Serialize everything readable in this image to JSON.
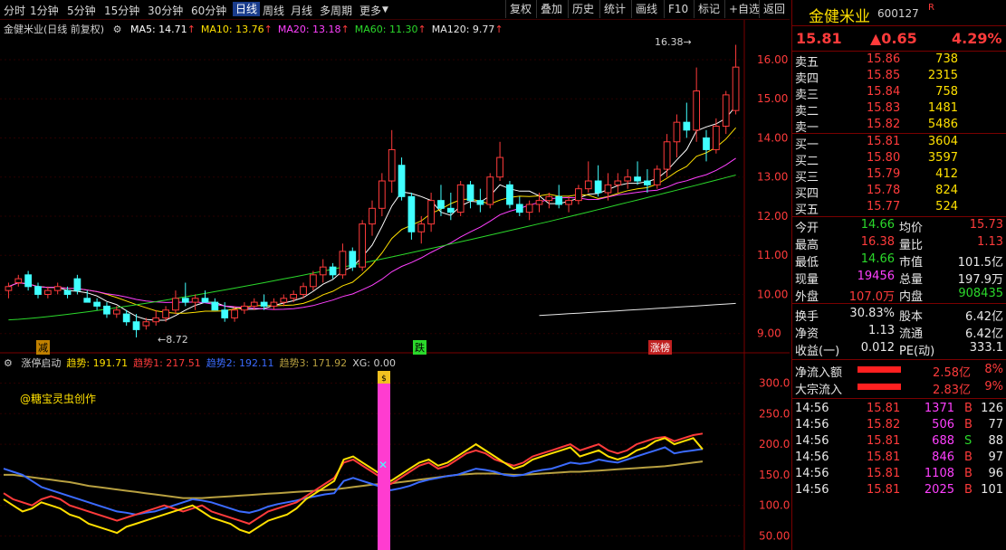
{
  "toolbar": {
    "periods": [
      "分时",
      "1分钟",
      "5分钟",
      "15分钟",
      "30分钟",
      "60分钟",
      "日线",
      "周线",
      "月线",
      "多周期",
      "更多"
    ],
    "active_period": "日线",
    "right_buttons": [
      "复权",
      "叠加",
      "历史",
      "统计",
      "画线",
      "F10",
      "标记",
      "+自选",
      "返回"
    ]
  },
  "chart_title": "金健米业(日线 前复权)",
  "ma_legend": [
    {
      "label": "MA5: 14.71",
      "color": "#ffffff"
    },
    {
      "label": "MA10: 13.76",
      "color": "#ffe000"
    },
    {
      "label": "MA20: 13.18",
      "color": "#ff40ff"
    },
    {
      "label": "MA60: 11.30",
      "color": "#2bd82b"
    },
    {
      "label": "MA120: 9.77",
      "color": "#e8e8e8"
    }
  ],
  "sub_legend": [
    {
      "label": "涨停启动",
      "color": "#d0d0d0"
    },
    {
      "label": "趋势: 191.71",
      "color": "#ffe000"
    },
    {
      "label": "趋势1: 217.51",
      "color": "#ff3b3b"
    },
    {
      "label": "趋势2: 192.11",
      "color": "#3b6bff"
    },
    {
      "label": "趋势3: 171.92",
      "color": "#b8a040"
    },
    {
      "label": "XG: 0.00",
      "color": "#d0d0d0"
    }
  ],
  "watermark_author": "@糖宝灵虫创作",
  "markers": {
    "low_label": "8.72",
    "high_label": "16.38",
    "tag1": "减",
    "tag2": "跌",
    "tag3": "涨榜"
  },
  "chart_data": [
    {
      "type": "candlestick",
      "title": "金健米业(日线 前复权)",
      "ylim": [
        8.6,
        16.6
      ],
      "y_ticks": [
        "9.00",
        "10.00",
        "11.00",
        "12.00",
        "13.00",
        "14.00",
        "15.00",
        "16.00"
      ],
      "ohlc": [
        [
          10.1,
          10.3,
          9.9,
          10.2
        ],
        [
          10.3,
          10.5,
          10.2,
          10.4
        ],
        [
          10.5,
          10.6,
          10.1,
          10.2
        ],
        [
          10.2,
          10.3,
          9.9,
          10.0
        ],
        [
          10.0,
          10.2,
          9.9,
          10.1
        ],
        [
          10.1,
          10.3,
          10.0,
          10.2
        ],
        [
          10.1,
          10.2,
          9.9,
          10.0
        ],
        [
          10.4,
          10.5,
          10.0,
          10.1
        ],
        [
          9.9,
          10.1,
          9.8,
          9.8
        ],
        [
          9.8,
          9.9,
          9.6,
          9.7
        ],
        [
          9.7,
          9.8,
          9.4,
          9.5
        ],
        [
          9.5,
          9.7,
          9.4,
          9.6
        ],
        [
          9.5,
          9.6,
          9.2,
          9.3
        ],
        [
          9.3,
          9.5,
          8.9,
          9.1
        ],
        [
          9.2,
          9.4,
          9.1,
          9.3
        ],
        [
          9.3,
          9.6,
          9.2,
          9.4
        ],
        [
          9.4,
          9.7,
          9.3,
          9.6
        ],
        [
          9.6,
          10.1,
          9.5,
          9.9
        ],
        [
          9.9,
          10.3,
          9.7,
          9.8
        ],
        [
          9.8,
          10.0,
          9.6,
          9.9
        ],
        [
          9.9,
          10.1,
          9.8,
          9.8
        ],
        [
          9.8,
          9.9,
          9.6,
          9.6
        ],
        [
          9.6,
          9.8,
          9.3,
          9.4
        ],
        [
          9.4,
          9.7,
          9.3,
          9.6
        ],
        [
          9.6,
          9.8,
          9.5,
          9.7
        ],
        [
          9.7,
          9.9,
          9.6,
          9.8
        ],
        [
          9.8,
          10.0,
          9.6,
          9.7
        ],
        [
          9.7,
          9.9,
          9.6,
          9.8
        ],
        [
          9.8,
          10.0,
          9.7,
          9.9
        ],
        [
          9.9,
          10.1,
          9.8,
          10.0
        ],
        [
          10.0,
          10.3,
          9.9,
          10.2
        ],
        [
          10.2,
          10.6,
          10.1,
          10.5
        ],
        [
          10.5,
          10.9,
          10.3,
          10.7
        ],
        [
          10.7,
          10.8,
          10.4,
          10.5
        ],
        [
          10.5,
          11.3,
          10.4,
          11.1
        ],
        [
          11.1,
          11.2,
          10.6,
          10.7
        ],
        [
          10.7,
          11.9,
          10.6,
          11.8
        ],
        [
          11.8,
          12.4,
          11.5,
          12.2
        ],
        [
          12.2,
          13.1,
          12.0,
          12.9
        ],
        [
          12.9,
          14.2,
          12.6,
          13.7
        ],
        [
          13.3,
          13.5,
          12.4,
          12.5
        ],
        [
          12.5,
          12.6,
          11.4,
          11.6
        ],
        [
          11.6,
          12.0,
          11.3,
          11.8
        ],
        [
          11.8,
          12.6,
          11.6,
          12.4
        ],
        [
          12.4,
          12.8,
          12.0,
          12.2
        ],
        [
          12.2,
          12.6,
          11.9,
          12.1
        ],
        [
          12.1,
          12.9,
          12.0,
          12.8
        ],
        [
          12.8,
          12.9,
          12.2,
          12.4
        ],
        [
          12.4,
          12.7,
          12.1,
          12.3
        ],
        [
          12.3,
          13.1,
          12.2,
          13.0
        ],
        [
          13.0,
          13.9,
          12.9,
          13.5
        ],
        [
          12.8,
          12.9,
          12.2,
          12.3
        ],
        [
          12.3,
          12.5,
          12.0,
          12.1
        ],
        [
          12.1,
          12.4,
          11.9,
          12.3
        ],
        [
          12.3,
          12.6,
          12.1,
          12.4
        ],
        [
          12.4,
          12.6,
          12.2,
          12.5
        ],
        [
          12.5,
          12.8,
          12.2,
          12.3
        ],
        [
          12.3,
          12.5,
          12.1,
          12.4
        ],
        [
          12.4,
          12.8,
          12.3,
          12.7
        ],
        [
          12.7,
          13.4,
          12.6,
          12.9
        ],
        [
          12.9,
          13.3,
          12.5,
          12.6
        ],
        [
          12.6,
          13.1,
          12.4,
          12.8
        ],
        [
          12.8,
          13.1,
          12.6,
          12.9
        ],
        [
          12.9,
          13.2,
          12.7,
          13.0
        ],
        [
          13.0,
          13.4,
          12.8,
          12.9
        ],
        [
          12.9,
          13.2,
          12.6,
          12.8
        ],
        [
          12.8,
          13.3,
          12.7,
          13.2
        ],
        [
          13.2,
          14.1,
          13.0,
          13.9
        ],
        [
          13.9,
          14.6,
          13.5,
          14.4
        ],
        [
          14.4,
          14.9,
          14.0,
          14.2
        ],
        [
          14.2,
          15.8,
          13.9,
          15.2
        ],
        [
          14.0,
          14.2,
          13.4,
          13.7
        ],
        [
          13.7,
          14.5,
          13.6,
          14.3
        ],
        [
          14.3,
          15.2,
          14.1,
          15.1
        ],
        [
          14.7,
          16.38,
          14.6,
          15.81
        ]
      ],
      "ma_series": [
        {
          "name": "MA5",
          "color": "#ffffff"
        },
        {
          "name": "MA10",
          "color": "#ffe000"
        },
        {
          "name": "MA20",
          "color": "#ff40ff"
        },
        {
          "name": "MA60",
          "color": "#2bd82b",
          "values": [
            9.35,
            13.05
          ]
        },
        {
          "name": "MA120",
          "color": "#e8e8e8",
          "values": [
            8.85,
            9.77
          ]
        }
      ]
    },
    {
      "type": "line",
      "title": "涨停启动",
      "ylim": [
        30,
        320
      ],
      "y_ticks": [
        "50.00",
        "100.0",
        "150.0",
        "200.0",
        "250.0",
        "300.0"
      ],
      "series": [
        {
          "name": "趋势",
          "color": "#ffe000",
          "values": [
            110,
            100,
            90,
            95,
            105,
            100,
            95,
            85,
            80,
            70,
            65,
            60,
            55,
            65,
            70,
            75,
            80,
            85,
            90,
            95,
            100,
            90,
            80,
            75,
            70,
            60,
            55,
            65,
            75,
            80,
            85,
            95,
            110,
            120,
            130,
            140,
            175,
            180,
            170,
            160,
            150,
            140,
            150,
            160,
            170,
            175,
            165,
            170,
            180,
            190,
            200,
            190,
            180,
            170,
            160,
            165,
            175,
            180,
            185,
            190,
            195,
            180,
            185,
            190,
            180,
            175,
            180,
            190,
            195,
            205,
            210,
            200,
            205,
            210,
            191.71
          ]
        },
        {
          "name": "趋势1",
          "color": "#ff3b3b",
          "values": [
            120,
            110,
            105,
            100,
            110,
            115,
            110,
            100,
            95,
            90,
            85,
            80,
            75,
            80,
            85,
            90,
            95,
            100,
            95,
            90,
            95,
            100,
            90,
            85,
            80,
            75,
            70,
            80,
            90,
            95,
            100,
            105,
            115,
            125,
            135,
            145,
            170,
            175,
            165,
            155,
            145,
            135,
            145,
            155,
            165,
            170,
            160,
            165,
            175,
            185,
            190,
            185,
            175,
            170,
            165,
            170,
            180,
            185,
            190,
            195,
            200,
            190,
            195,
            200,
            190,
            185,
            190,
            200,
            205,
            210,
            212,
            205,
            210,
            215,
            217.51
          ]
        },
        {
          "name": "趋势2",
          "color": "#3b6bff",
          "values": [
            160,
            155,
            150,
            140,
            130,
            125,
            120,
            115,
            110,
            105,
            100,
            95,
            90,
            88,
            85,
            88,
            90,
            95,
            100,
            105,
            110,
            108,
            105,
            100,
            95,
            90,
            88,
            92,
            98,
            102,
            105,
            108,
            112,
            115,
            118,
            120,
            140,
            145,
            140,
            135,
            130,
            125,
            128,
            132,
            138,
            142,
            145,
            148,
            150,
            155,
            160,
            158,
            155,
            150,
            148,
            150,
            155,
            158,
            160,
            165,
            170,
            168,
            170,
            175,
            172,
            170,
            175,
            180,
            185,
            190,
            195,
            185,
            188,
            190,
            192.11
          ]
        },
        {
          "name": "趋势3",
          "color": "#b8a040",
          "values": [
            150,
            150,
            148,
            146,
            144,
            142,
            140,
            138,
            135,
            132,
            130,
            128,
            126,
            124,
            122,
            120,
            118,
            116,
            114,
            112,
            112,
            112,
            113,
            114,
            115,
            116,
            117,
            118,
            119,
            120,
            121,
            122,
            123,
            124,
            125,
            126,
            128,
            130,
            132,
            134,
            135,
            136,
            138,
            140,
            142,
            144,
            146,
            148,
            150,
            151,
            152,
            152,
            152,
            151,
            150,
            150,
            151,
            152,
            153,
            154,
            155,
            155,
            156,
            157,
            158,
            159,
            160,
            161,
            162,
            163,
            164,
            166,
            168,
            170,
            171.92
          ]
        }
      ]
    }
  ],
  "quote": {
    "name": "金健米业",
    "code": "600127",
    "flag": "R",
    "price": "15.81",
    "change": "▲0.65",
    "pct": "4.29%",
    "asks": [
      {
        "label": "卖五",
        "price": "15.86",
        "vol": "738"
      },
      {
        "label": "卖四",
        "price": "15.85",
        "vol": "2315"
      },
      {
        "label": "卖三",
        "price": "15.84",
        "vol": "758"
      },
      {
        "label": "卖二",
        "price": "15.83",
        "vol": "1481"
      },
      {
        "label": "卖一",
        "price": "15.82",
        "vol": "5486"
      }
    ],
    "bids": [
      {
        "label": "买一",
        "price": "15.81",
        "vol": "3604"
      },
      {
        "label": "买二",
        "price": "15.80",
        "vol": "3597"
      },
      {
        "label": "买三",
        "price": "15.79",
        "vol": "412"
      },
      {
        "label": "买四",
        "price": "15.78",
        "vol": "824"
      },
      {
        "label": "买五",
        "price": "15.77",
        "vol": "524"
      }
    ],
    "stats": [
      {
        "k1": "今开",
        "v1": "14.66",
        "c1": "#2bd82b",
        "k2": "均价",
        "v2": "15.73",
        "c2": "#ff3b3b"
      },
      {
        "k1": "最高",
        "v1": "16.38",
        "c1": "#ff3b3b",
        "k2": "量比",
        "v2": "1.13",
        "c2": "#ff3b3b"
      },
      {
        "k1": "最低",
        "v1": "14.66",
        "c1": "#2bd82b",
        "k2": "市值",
        "v2": "101.5亿",
        "c2": "#e8e8e8"
      },
      {
        "k1": "现量",
        "v1": "19456",
        "c1": "#ff40ff",
        "k2": "总量",
        "v2": "197.9万",
        "c2": "#e8e8e8"
      },
      {
        "k1": "外盘",
        "v1": "107.0万",
        "c1": "#ff3b3b",
        "k2": "内盘",
        "v2": "908435",
        "c2": "#2bd82b"
      }
    ],
    "stats2": [
      {
        "k1": "换手",
        "v1": "30.83%",
        "k2": "股本",
        "v2": "6.42亿"
      },
      {
        "k1": "净资",
        "v1": "1.13",
        "k2": "流通",
        "v2": "6.42亿"
      },
      {
        "k1": "收益(一)",
        "v1": "0.012",
        "k2": "PE(动)",
        "v2": "333.1"
      }
    ],
    "flows": [
      {
        "label": "净流入额",
        "value": "2.58亿",
        "pct": "8%"
      },
      {
        "label": "大宗流入",
        "value": "2.83亿",
        "pct": "9%"
      }
    ],
    "ticks": [
      {
        "time": "14:56",
        "price": "15.81",
        "vol": "1371",
        "side": "B",
        "n": "126"
      },
      {
        "time": "14:56",
        "price": "15.82",
        "vol": "506",
        "side": "B",
        "n": "77"
      },
      {
        "time": "14:56",
        "price": "15.81",
        "vol": "688",
        "side": "S",
        "n": "88"
      },
      {
        "time": "14:56",
        "price": "15.81",
        "vol": "846",
        "side": "B",
        "n": "97"
      },
      {
        "time": "14:56",
        "price": "15.81",
        "vol": "1108",
        "side": "B",
        "n": "96"
      },
      {
        "time": "14:56",
        "price": "15.81",
        "vol": "2025",
        "side": "B",
        "n": "101"
      }
    ]
  }
}
